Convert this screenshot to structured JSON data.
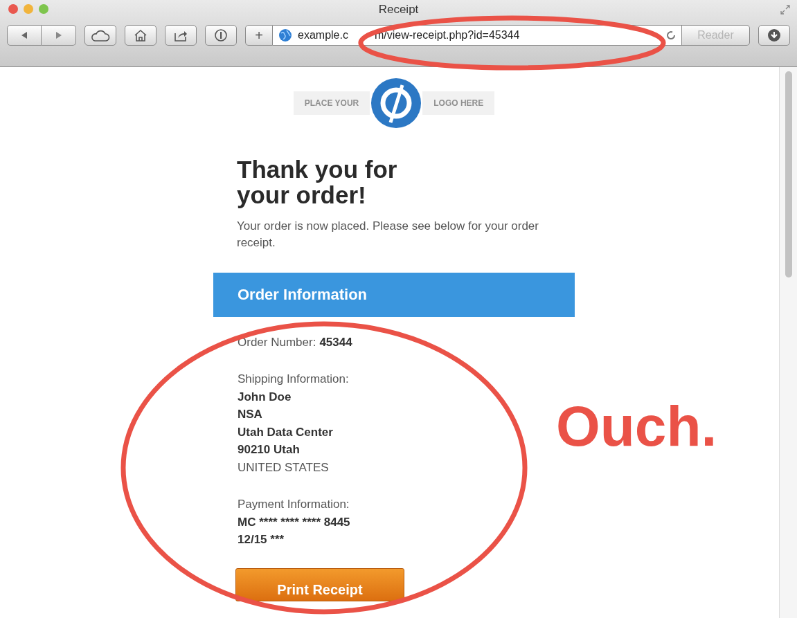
{
  "window": {
    "title": "Receipt"
  },
  "toolbar": {
    "buttons": [
      {
        "kind": "back"
      },
      {
        "kind": "forward"
      },
      {
        "kind": "cloud"
      },
      {
        "kind": "home"
      },
      {
        "kind": "share"
      },
      {
        "kind": "info"
      }
    ],
    "add_label": "+",
    "url_visible_start": "example.c",
    "url_visible_end": "m/view-receipt.php?id=45344",
    "reader_label": "Reader",
    "reader_disabled": true
  },
  "logo": {
    "left_text": "PLACE YOUR",
    "right_text": "LOGO HERE"
  },
  "heading": "Thank you for your order!",
  "intro": "Your order is now placed. Please see below for your order receipt.",
  "section_title": "Order Information",
  "order_number": {
    "label": "Order Number:",
    "value": "45344"
  },
  "shipping": {
    "label": "Shipping Information:",
    "lines": [
      {
        "text": "John Doe",
        "bold": true
      },
      {
        "text": "NSA",
        "bold": true
      },
      {
        "text": "Utah Data Center",
        "bold": true
      },
      {
        "text": "90210 Utah",
        "bold": true
      },
      {
        "text": "UNITED STATES",
        "bold": false
      }
    ]
  },
  "payment": {
    "label": "Payment Information:",
    "lines": [
      {
        "text": "MC **** **** **** 8445",
        "bold": true
      },
      {
        "text": "12/15 ***",
        "bold": true
      }
    ]
  },
  "print_button": "Print Receipt",
  "annotations": [
    {
      "kind": "ellipse"
    },
    {
      "kind": "ellipse"
    },
    {
      "kind": "text",
      "text": "Ouch."
    }
  ]
}
